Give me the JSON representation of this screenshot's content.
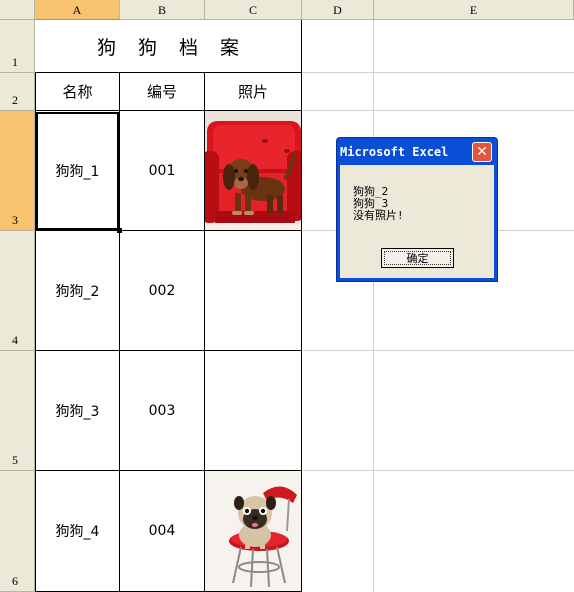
{
  "columns": [
    "A",
    "B",
    "C",
    "D",
    "E"
  ],
  "rows": [
    "1",
    "2",
    "3",
    "4",
    "5",
    "6"
  ],
  "sheet": {
    "title_chars": [
      "狗",
      "狗",
      "档",
      "案"
    ],
    "headers": {
      "name": "名称",
      "number": "编号",
      "photo": "照片"
    },
    "records": [
      {
        "name": "狗狗_1",
        "number": "001",
        "photo": "dachshund-photo"
      },
      {
        "name": "狗狗_2",
        "number": "002",
        "photo": ""
      },
      {
        "name": "狗狗_3",
        "number": "003",
        "photo": ""
      },
      {
        "name": "狗狗_4",
        "number": "004",
        "photo": "pug-photo"
      }
    ]
  },
  "dialog": {
    "title": "Microsoft Excel",
    "lines": [
      "狗狗_2",
      "狗狗_3",
      "没有照片!"
    ],
    "ok_label": "确定",
    "close_icon": "close-icon"
  },
  "colors": {
    "active_header": "#f8c36e",
    "dialog_title": "#0a4ed6",
    "dialog_body": "#ece9d8"
  }
}
